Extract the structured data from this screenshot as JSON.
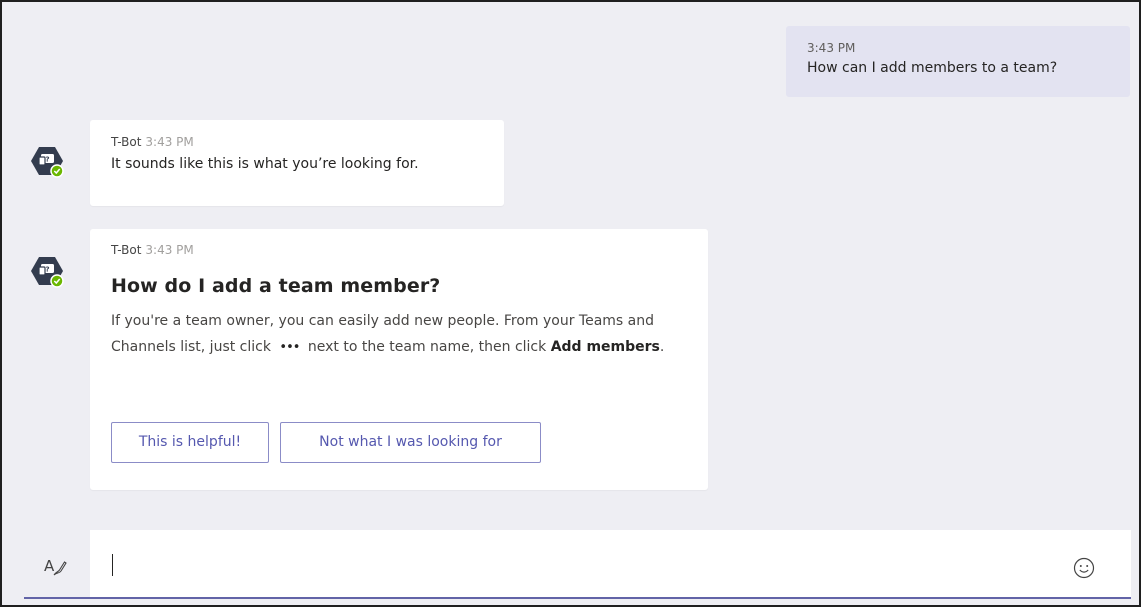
{
  "sent": {
    "time": "3:43 PM",
    "text": "How can I add members to a team?"
  },
  "bot_messages": [
    {
      "sender": "T-Bot",
      "time": "3:43 PM",
      "text": "It sounds like this is what you’re looking for."
    },
    {
      "sender": "T-Bot",
      "time": "3:43 PM",
      "card": {
        "title": "How do I add a team member?",
        "body_part1": "If you're a team owner, you can easily add new people. From your Teams and Channels list, just click",
        "dots": "•••",
        "body_part2": "next to the team name, then click",
        "body_bold": "Add members",
        "body_end": ".",
        "buttons": [
          "This is helpful!",
          "Not what I was looking for"
        ]
      }
    }
  ],
  "compose": {
    "value": "",
    "format_icon": "format-text-icon",
    "emoji_icon": "emoji-icon"
  },
  "colors": {
    "accent": "#6264a7",
    "button_text": "#5558af",
    "button_border": "#8b8cc7",
    "presence": "#6bb700",
    "avatar": "#333c4e",
    "sent_bubble": "#e3e3f1"
  }
}
